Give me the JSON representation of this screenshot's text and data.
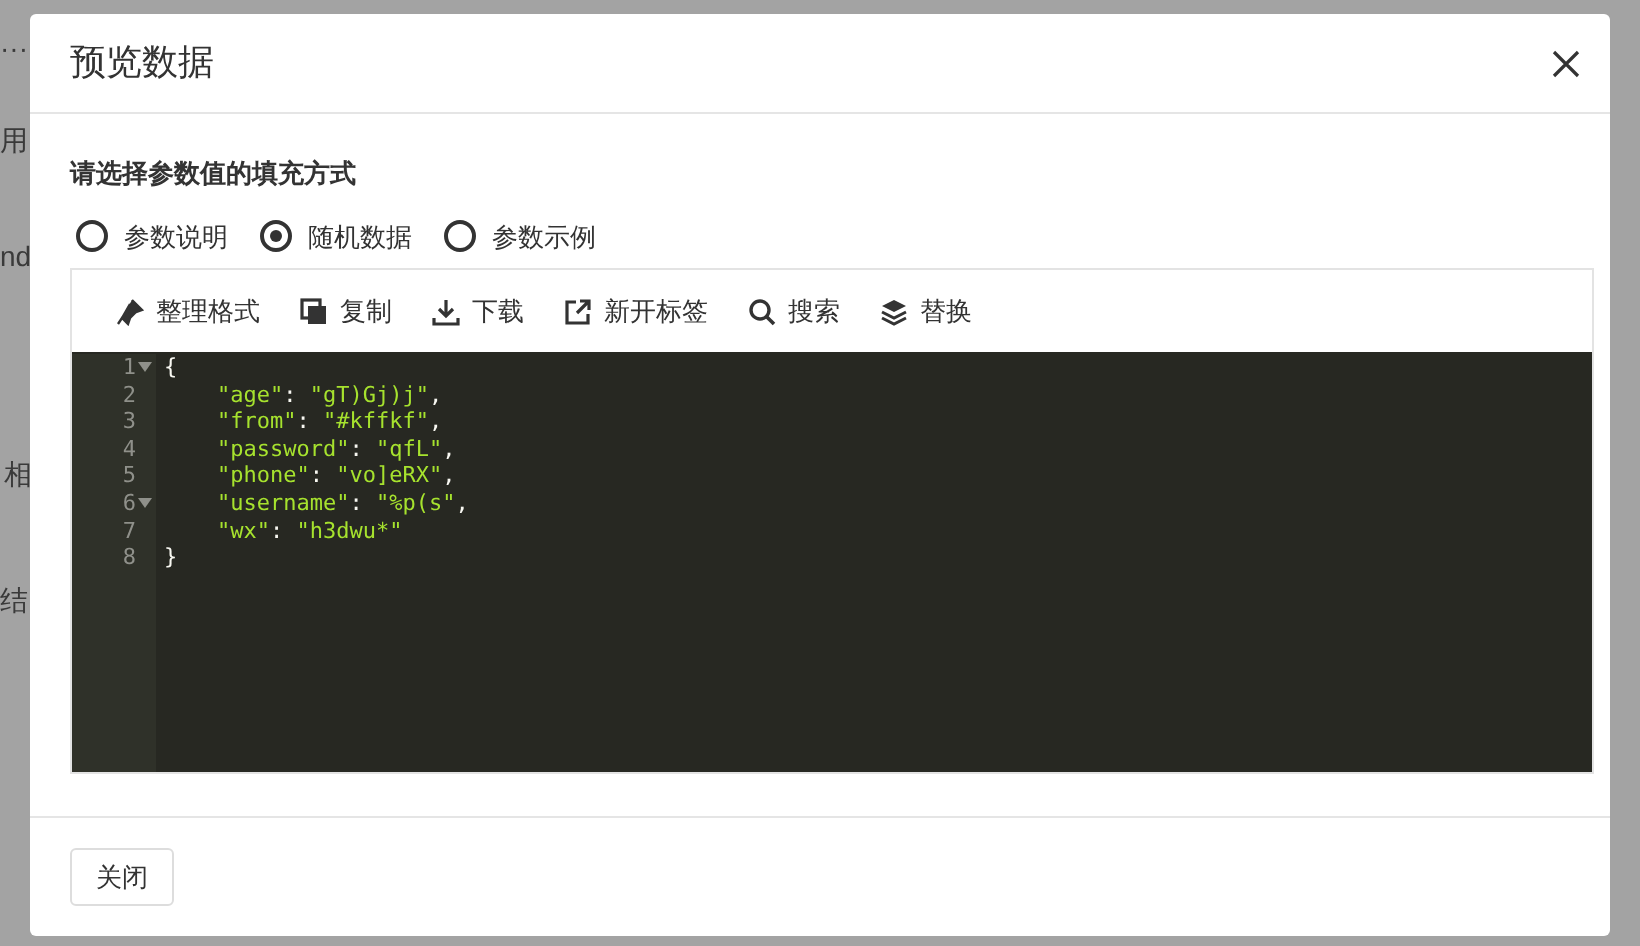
{
  "background": {
    "fragments": [
      "···",
      "用",
      "nd",
      "相",
      "结"
    ]
  },
  "modal": {
    "title": "预览数据",
    "prompt": "请选择参数值的填充方式",
    "radios": [
      {
        "label": "参数说明",
        "selected": false
      },
      {
        "label": "随机数据",
        "selected": true
      },
      {
        "label": "参数示例",
        "selected": false
      }
    ],
    "toolbar": [
      {
        "label": "整理格式",
        "kind": "format"
      },
      {
        "label": "复制",
        "kind": "copy"
      },
      {
        "label": "下载",
        "kind": "download"
      },
      {
        "label": "新开标签",
        "kind": "external"
      },
      {
        "label": "搜索",
        "kind": "search"
      },
      {
        "label": "替换",
        "kind": "replace"
      }
    ],
    "editor": {
      "lines": [
        {
          "number": "1",
          "text": "{",
          "foldable": true
        },
        {
          "number": "2",
          "text": "    \"age\": \"gT)Gj)j\",",
          "foldable": false
        },
        {
          "number": "3",
          "text": "    \"from\": \"#kffkf\",",
          "foldable": false
        },
        {
          "number": "4",
          "text": "    \"password\": \"qfL\",",
          "foldable": false
        },
        {
          "number": "5",
          "text": "    \"phone\": \"vo]eRX\",",
          "foldable": false
        },
        {
          "number": "6",
          "text": "    \"username\": \"%p(s\",",
          "foldable": true
        },
        {
          "number": "7",
          "text": "    \"wx\": \"h3dwu*\"",
          "foldable": false
        },
        {
          "number": "8",
          "text": "}",
          "foldable": false
        }
      ]
    },
    "footer_button": "关闭"
  }
}
